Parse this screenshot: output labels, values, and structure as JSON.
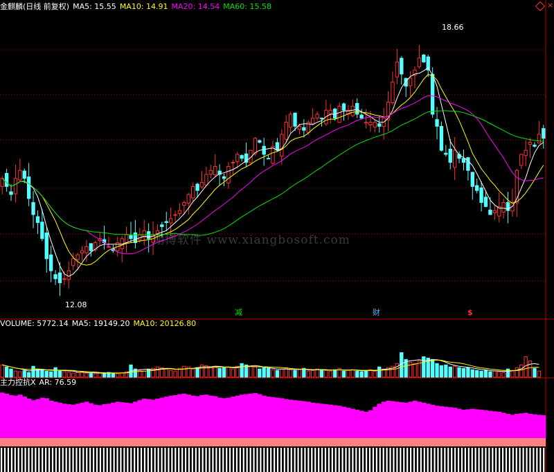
{
  "price_header": {
    "title": "金麒麟(日线 前复权)",
    "ma5": "MA5: 15.55",
    "ma10": "MA10: 14.91",
    "ma20": "MA20: 14.54",
    "ma60": "MA60: 15.58"
  },
  "volume_header": {
    "volume": "VOLUME: 5772.14",
    "ma5": "MA5: 19149.20",
    "ma10": "MA10: 20126.80"
  },
  "indicator_header": {
    "title": "主力控抗X",
    "ar": "AR: 76.59"
  },
  "markers": {
    "high": "18.66",
    "low": "12.08",
    "jian": "减",
    "cai": "财",
    "dollar": "$"
  },
  "watermark": "翔博软件 www.xiangbosoft.com",
  "colors": {
    "up": "#ff3232",
    "down": "#54ffff",
    "ma5": "#ffffff",
    "ma10": "#ffff00",
    "ma20": "#ff00ff",
    "ma60": "#00e600",
    "grid": "#aa0000",
    "ar": "#ff00ff",
    "ar_base": "#ff8080"
  },
  "chart_data": [
    {
      "type": "candlestick",
      "title": "金麒麟(日线 前复权)",
      "ylim": [
        11.5,
        19.0
      ],
      "high_label": 18.66,
      "low_label": 12.08,
      "closes": [
        14.9,
        14.7,
        14.5,
        14.9,
        15.1,
        14.9,
        14.4,
        14.0,
        13.8,
        13.4,
        12.9,
        12.6,
        12.4,
        12.3,
        12.4,
        12.6,
        12.9,
        13.0,
        13.1,
        13.2,
        13.1,
        13.3,
        13.4,
        13.3,
        13.2,
        13.1,
        13.3,
        13.4,
        13.5,
        13.4,
        13.3,
        13.5,
        13.6,
        13.4,
        13.5,
        13.6,
        13.7,
        13.8,
        13.9,
        14.0,
        14.1,
        14.3,
        14.5,
        14.7,
        14.6,
        14.8,
        15.0,
        15.1,
        15.2,
        15.0,
        14.9,
        15.2,
        15.3,
        15.5,
        15.4,
        15.3,
        15.6,
        15.9,
        15.8,
        15.5,
        15.4,
        15.7,
        15.6,
        16.0,
        16.3,
        16.5,
        16.2,
        16.2,
        16.1,
        16.3,
        16.4,
        16.5,
        16.4,
        16.6,
        16.6,
        16.4,
        16.7,
        16.6,
        16.6,
        16.7,
        16.5,
        16.4,
        16.3,
        16.3,
        16.3,
        16.2,
        16.4,
        16.8,
        17.3,
        17.8,
        17.5,
        17.2,
        17.4,
        17.6,
        17.9,
        17.8,
        17.6,
        16.5,
        16.2,
        15.6,
        15.5,
        15.3,
        15.6,
        15.4,
        15.3,
        15.1,
        14.7,
        14.6,
        14.3,
        14.2,
        14.0,
        14.1,
        14.2,
        14.3,
        14.1,
        14.3,
        15.1,
        15.5,
        15.6,
        15.8,
        15.7,
        16.0,
        15.9
      ],
      "series": [
        {
          "name": "MA5",
          "value": 15.55
        },
        {
          "name": "MA10",
          "value": 14.91
        },
        {
          "name": "MA20",
          "value": 14.54
        },
        {
          "name": "MA60",
          "value": 15.58
        }
      ]
    },
    {
      "type": "bar",
      "title": "VOLUME",
      "volume": 5772.14,
      "ma5": 19149.2,
      "ma10": 20126.8,
      "ylim": [
        0,
        70000
      ],
      "values": [
        18000,
        15000,
        12000,
        9000,
        8000,
        9500,
        7000,
        16000,
        12000,
        10000,
        9000,
        8000,
        14000,
        9000,
        8000,
        7000,
        6000,
        7000,
        8000,
        6000,
        5500,
        5000,
        6000,
        6500,
        7000,
        6000,
        5000,
        6500,
        8000,
        18000,
        12000,
        10000,
        9000,
        11000,
        13000,
        15000,
        14000,
        12000,
        10000,
        9000,
        13000,
        16000,
        15000,
        12000,
        14000,
        18000,
        17000,
        15000,
        16000,
        13000,
        14000,
        15000,
        12000,
        16000,
        20000,
        18000,
        16000,
        15000,
        12000,
        14000,
        13000,
        11000,
        10000,
        12000,
        14000,
        11000,
        10000,
        11000,
        13000,
        9000,
        10000,
        12000,
        11000,
        10000,
        9000,
        11000,
        13000,
        9000,
        10000,
        11000,
        9000,
        8000,
        10000,
        11000,
        9000,
        15000,
        12000,
        14000,
        16000,
        20000,
        36000,
        26000,
        22000,
        20000,
        24000,
        30000,
        28000,
        26000,
        20000,
        17000,
        18000,
        15000,
        16000,
        14000,
        13000,
        14000,
        11000,
        10000,
        9000,
        10000,
        8000,
        9000,
        8000,
        7000,
        12000,
        10000,
        14000,
        18000,
        30000,
        24000,
        13000,
        9000
      ]
    },
    {
      "type": "bar",
      "title": "主力控抗X",
      "ar": 76.59,
      "ylim": [
        0,
        100
      ],
      "values": [
        90,
        88,
        85,
        84,
        86,
        82,
        78,
        75,
        77,
        80,
        79,
        74,
        72,
        70,
        68,
        67,
        66,
        68,
        70,
        72,
        69,
        66,
        65,
        67,
        68,
        70,
        72,
        71,
        70,
        69,
        72,
        75,
        78,
        77,
        76,
        78,
        80,
        82,
        84,
        85,
        87,
        88,
        86,
        84,
        83,
        85,
        86,
        84,
        83,
        80,
        79,
        80,
        82,
        84,
        86,
        87,
        88,
        89,
        87,
        84,
        82,
        81,
        80,
        79,
        77,
        76,
        75,
        74,
        73,
        72,
        70,
        69,
        68,
        67,
        66,
        65,
        64,
        62,
        60,
        58,
        56,
        54,
        52,
        55,
        62,
        68,
        72,
        74,
        73,
        72,
        71,
        70,
        72,
        74,
        72,
        70,
        68,
        66,
        64,
        63,
        62,
        61,
        60,
        58,
        56,
        57,
        58,
        57,
        56,
        55,
        54,
        53,
        52,
        50,
        48,
        46,
        48,
        49,
        50,
        48,
        47,
        46,
        45
      ]
    }
  ]
}
